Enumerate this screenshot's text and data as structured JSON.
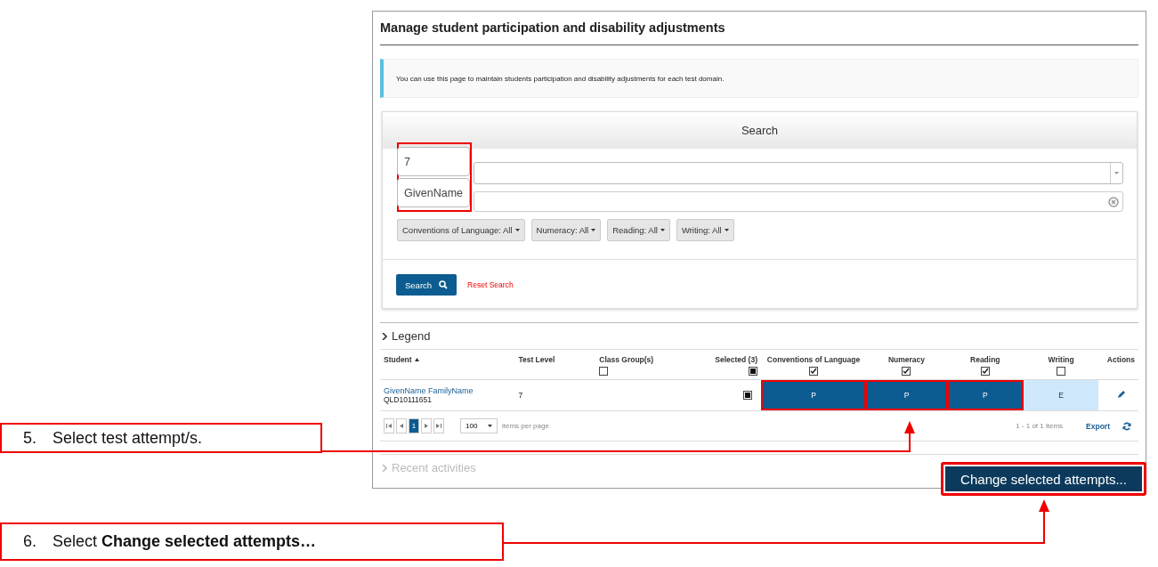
{
  "page": {
    "title": "Manage student participation and disability adjustments",
    "info": "You can use this page to maintain students participation and disability adjustments for each test domain."
  },
  "search": {
    "title": "Search",
    "zoomed_values": [
      "7",
      "GivenName"
    ],
    "highlighted": true,
    "filters": [
      {
        "label": "Conventions of Language: All"
      },
      {
        "label": "Numeracy: All"
      },
      {
        "label": "Reading: All"
      },
      {
        "label": "Writing: All"
      }
    ],
    "search_button": "Search",
    "reset_link": "Reset Search"
  },
  "legend": {
    "label": "Legend",
    "expanded": false
  },
  "table": {
    "columns": [
      {
        "label": "Student",
        "sorted_ascending": true
      },
      {
        "label": "Test Level"
      },
      {
        "label": "Class Group(s)",
        "checkbox": {
          "checked": false
        }
      },
      {
        "label": "Selected (3)",
        "checkbox": {
          "checked": true,
          "partial": true
        }
      },
      {
        "label": "Conventions of Language",
        "checkbox": {
          "checked": true
        }
      },
      {
        "label": "Numeracy",
        "checkbox": {
          "checked": true
        }
      },
      {
        "label": "Reading",
        "checkbox": {
          "checked": true
        }
      },
      {
        "label": "Writing",
        "checkbox": {
          "checked": false
        }
      },
      {
        "label": "Actions"
      }
    ],
    "rows": [
      {
        "name": "GivenName FamilyName",
        "id": "QLD10111651",
        "test_level": "7",
        "checkbox": {
          "checked": true,
          "partial": true
        },
        "attempts": [
          {
            "label": "P",
            "selected": true,
            "highlighted": true
          },
          {
            "label": "P",
            "selected": true,
            "highlighted": true
          },
          {
            "label": "P",
            "selected": true,
            "highlighted": true
          },
          {
            "label": "E",
            "selected": false,
            "highlighted": false
          }
        ]
      }
    ]
  },
  "pager": {
    "pages": [
      {
        "label": "1",
        "selected": true
      }
    ],
    "page_size": "100",
    "page_size_label": "items per page",
    "summary": "1 - 1 of 1 items",
    "export": "Export"
  },
  "recent_activities": {
    "label": "Recent activities",
    "expanded": false
  },
  "change_button": {
    "label": "Change selected attempts...",
    "highlighted": true
  },
  "callouts": [
    {
      "number": "5.",
      "text": "Select test attempt/s."
    },
    {
      "number": "6.",
      "text": "Select **Change selected attempts…**"
    }
  ]
}
